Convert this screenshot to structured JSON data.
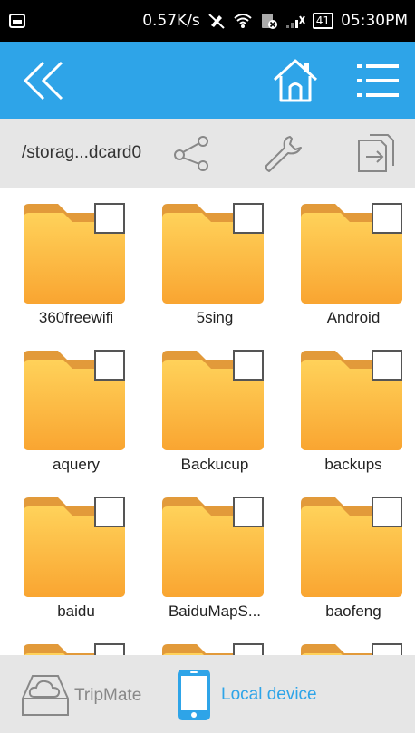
{
  "status_bar": {
    "speed": "0.57K/s",
    "time": "05:30PM",
    "battery": "41",
    "icons": [
      "image-icon",
      "mute-icon",
      "wifi-icon",
      "no-sim-icon",
      "signal-icon",
      "battery-icon"
    ]
  },
  "toolbar": {
    "back_icon": "double-chevron-left-icon",
    "home_icon": "home-icon",
    "menu_icon": "list-menu-icon",
    "color": "#2ea4e8"
  },
  "path_bar": {
    "path": "/storag...dcard0",
    "share_icon": "share-icon",
    "tools_icon": "wrench-icon",
    "exit_icon": "exit-icon"
  },
  "folders": [
    {
      "name": "360freewifi"
    },
    {
      "name": "5sing"
    },
    {
      "name": "Android"
    },
    {
      "name": "aquery"
    },
    {
      "name": "Backucup"
    },
    {
      "name": "backups"
    },
    {
      "name": "baidu"
    },
    {
      "name": "BaiduMapS..."
    },
    {
      "name": "baofeng"
    },
    {
      "name": ""
    },
    {
      "name": ""
    },
    {
      "name": ""
    }
  ],
  "bottom_bar": {
    "tripmate_label": "TripMate",
    "local_label": "Local device",
    "active_color": "#2ea4e8",
    "inactive_color": "#888888"
  }
}
